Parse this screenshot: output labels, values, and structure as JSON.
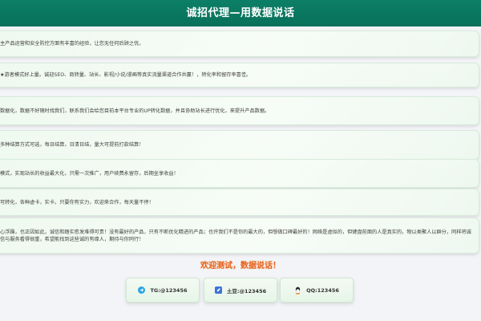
{
  "header": {
    "title": "诚招代理—用数据说话"
  },
  "cards": [
    {
      "text": "主产品运营和安全防控方面有丰富的经验，让您无任何后顾之忧。"
    },
    {
      "text": "★游者模式好上量。诚迎SEO、商转量、站长、影视/小说/漫画等真实流量渠道合作共赢！，转化率和留存率喜佳。"
    },
    {
      "text": "数据化，数据不好随时找我们，联系我们会给您目前本平台专业的UP转化数据，并且协助站长进行优化，来提升产品数据。"
    },
    {
      "text": "多种结算方式可选，每日结算，日清日结，量大可提前打款结算！"
    },
    {
      "text": "模式，实现站长的收益最大化，只需一次推广，用户续费永留存，后期坐享收益！"
    },
    {
      "text": "可转化，各种虚卡，实卡，只要你有实力，欢迎来合作，每天量不停！"
    },
    {
      "text": "心浮躁，也正因如此，诚信和踏实愈发难得可贵！没有最好的产品，只有不断优化精进的产品；也许我们不是你的最大的，但想做口碑最好的！网络是虚拟的，但键盘前面的人是真实的，物以类聚人以群分，同样将诚信与服务看得很重，希望能找到这些诚的有缘人，期待与你同行！"
    }
  ],
  "slogan": "欢迎测试，数据说话！",
  "contacts": [
    {
      "label": "TG:@123456",
      "icon": "telegram-icon",
      "color": "#2aa3df"
    },
    {
      "label": "土豆:@123456",
      "icon": "potato-icon",
      "color": "#3b73d9"
    },
    {
      "label": "QQ:123456",
      "icon": "qq-icon",
      "color": "#e0342b"
    }
  ]
}
